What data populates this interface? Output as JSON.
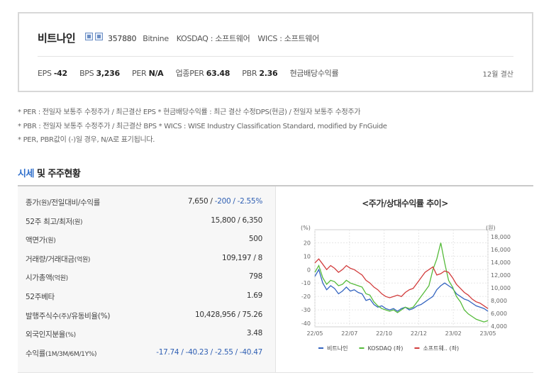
{
  "company": {
    "name": "비트나인",
    "code": "357880",
    "eng_name": "Bitnine",
    "market": "KOSDAQ : 소프트웨어",
    "wics": "WICS : 소프트웨어",
    "icons": [
      "home-icon",
      "ir-icon"
    ]
  },
  "metrics": [
    {
      "label": "EPS",
      "value": "-42"
    },
    {
      "label": "BPS",
      "value": "3,236"
    },
    {
      "label": "PER",
      "value": "N/A"
    },
    {
      "label": "업종PER",
      "value": "63.48"
    },
    {
      "label": "PBR",
      "value": "2.36"
    },
    {
      "label": "현금배당수익률",
      "value": ""
    }
  ],
  "fiscal_note": "12월 결산",
  "notes": [
    "* PER : 전일자 보통주 수정주가 / 최근결산 EPS * 현금배당수익률 : 최근 결산 수정DPS(현금) / 전일자 보통주 수정주가",
    "* PBR : 전일자 보통주 수정주가 / 최근결산 BPS * WICS : WISE Industry Classification Standard, modified by FnGuide",
    "* PER, PBR값이 (-)일 경우, N/A로 표기됩니다."
  ],
  "section_title": {
    "highlight": "시세",
    "rest": " 및 주주현황"
  },
  "table": {
    "rows": [
      {
        "label": "종가",
        "unit": "(원)",
        "label2": "/전일대비/수익률",
        "value": "7,650 / ",
        "blue": "-200 / -2.55%"
      },
      {
        "label": "52주 최고/최저",
        "unit": "(원)",
        "label2": "",
        "value": "15,800 / 6,350",
        "blue": ""
      },
      {
        "label": "액면가",
        "unit": "(원)",
        "label2": "",
        "value": "500",
        "blue": ""
      },
      {
        "label": "거래량/거래대금",
        "unit": "(억원)",
        "label2": "",
        "value": "109,197 / 8",
        "blue": ""
      },
      {
        "label": "시가총액",
        "unit": "(억원)",
        "label2": "",
        "value": "798",
        "blue": ""
      },
      {
        "label": "52주베타",
        "unit": "",
        "label2": "",
        "value": "1.69",
        "blue": ""
      },
      {
        "label": "발행주식수",
        "unit": "(주)",
        "label2": "/유동비율(%)",
        "value": "10,428,956 / 75.26",
        "blue": ""
      },
      {
        "label": "외국인지분율",
        "unit": "(%)",
        "label2": "",
        "value": "3.48",
        "blue": ""
      },
      {
        "label": "수익률",
        "unit": "(1M/3M/6M/1Y%)",
        "label2": "",
        "value": "",
        "blue": "-17.74 / -40.23 / -2.55 / -40.47"
      }
    ]
  },
  "chart_data": {
    "type": "line",
    "title": "<주가/상대수익률 추이>",
    "left_axis_label": "(%)",
    "right_axis_label": "(원)",
    "x_ticks": [
      "22/05",
      "22/07",
      "22/10",
      "22/12",
      "23/02",
      "23/05"
    ],
    "ylim_left": [
      -40,
      25
    ],
    "left_ticks": [
      20,
      10,
      0,
      -10,
      -20,
      -30,
      -40
    ],
    "ylim_right": [
      4000,
      18000
    ],
    "right_ticks": [
      "18,000",
      "16,000",
      "14,000",
      "12,000",
      "10,000",
      "8,000",
      "6,000",
      "4,000"
    ],
    "right_tick_values": [
      18000,
      16000,
      14000,
      12000,
      10000,
      8000,
      6000,
      4000
    ],
    "series": [
      {
        "name": "비트나인",
        "axis": "left",
        "color": "#3565c0",
        "values": [
          -5,
          0,
          -10,
          -15,
          -12,
          -14,
          -18,
          -16,
          -13,
          -16,
          -15,
          -17,
          -18,
          -23,
          -22,
          -26,
          -28,
          -27,
          -29,
          -30,
          -29,
          -31,
          -29,
          -28,
          -30,
          -29,
          -27,
          -26,
          -24,
          -22,
          -20,
          -15,
          -12,
          -10,
          -12,
          -14,
          -18,
          -20,
          -22,
          -23,
          -25,
          -27,
          -28,
          -29,
          -31
        ]
      },
      {
        "name": "KOSDAQ (좌)",
        "axis": "left",
        "color": "#55bb3a",
        "values": [
          -2,
          3,
          -6,
          -11,
          -8,
          -9,
          -12,
          -11,
          -8,
          -10,
          -11,
          -12,
          -13,
          -18,
          -19,
          -24,
          -27,
          -29,
          -30,
          -31,
          -30,
          -32,
          -30,
          -28,
          -29,
          -28,
          -24,
          -20,
          -16,
          -12,
          0,
          8,
          20,
          5,
          -8,
          -13,
          -20,
          -24,
          -30,
          -33,
          -35,
          -37,
          -38,
          -39,
          -38
        ]
      },
      {
        "name": "소프트웨.. (좌)",
        "axis": "left",
        "color": "#d23c3c",
        "values": [
          5,
          8,
          4,
          0,
          3,
          1,
          -2,
          0,
          3,
          1,
          0,
          -2,
          -4,
          -8,
          -10,
          -13,
          -15,
          -18,
          -20,
          -21,
          -20,
          -19,
          -20,
          -17,
          -15,
          -14,
          -10,
          -6,
          -2,
          0,
          2,
          -4,
          -3,
          -1,
          -2,
          -6,
          -11,
          -14,
          -17,
          -19,
          -22,
          -24,
          -25,
          -27,
          -29
        ]
      }
    ]
  }
}
